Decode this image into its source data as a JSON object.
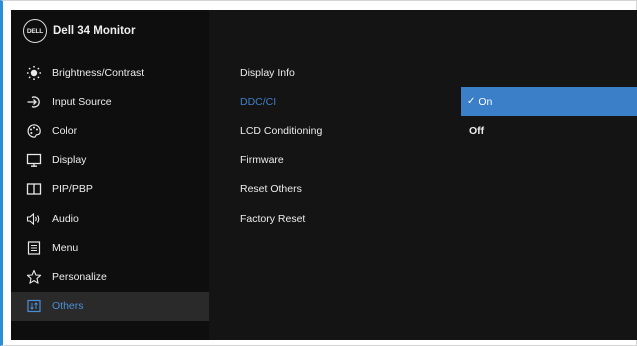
{
  "brand": {
    "logo_text": "DELL",
    "title": "Dell 34 Monitor"
  },
  "colors": {
    "accent": "#3a7fc8",
    "active_text": "#4a8fd6",
    "panel": "#141414",
    "sidebar": "#0e0e0e"
  },
  "sidebar": {
    "items": [
      {
        "label": "Brightness/Contrast",
        "icon": "brightness-icon"
      },
      {
        "label": "Input Source",
        "icon": "input-source-icon"
      },
      {
        "label": "Color",
        "icon": "color-palette-icon"
      },
      {
        "label": "Display",
        "icon": "display-icon"
      },
      {
        "label": "PIP/PBP",
        "icon": "pip-pbp-icon"
      },
      {
        "label": "Audio",
        "icon": "audio-icon"
      },
      {
        "label": "Menu",
        "icon": "menu-icon"
      },
      {
        "label": "Personalize",
        "icon": "star-icon"
      },
      {
        "label": "Others",
        "icon": "others-icon",
        "active": true
      }
    ]
  },
  "submenu": {
    "items": [
      {
        "label": "Display Info"
      },
      {
        "label": "DDC/CI",
        "active": true
      },
      {
        "label": "LCD Conditioning"
      },
      {
        "label": "Firmware"
      },
      {
        "label": "Reset Others"
      },
      {
        "label": "Factory Reset"
      }
    ]
  },
  "options": {
    "check_mark": "✓",
    "items": [
      {
        "label": "On",
        "selected": true
      },
      {
        "label": "Off"
      }
    ]
  }
}
